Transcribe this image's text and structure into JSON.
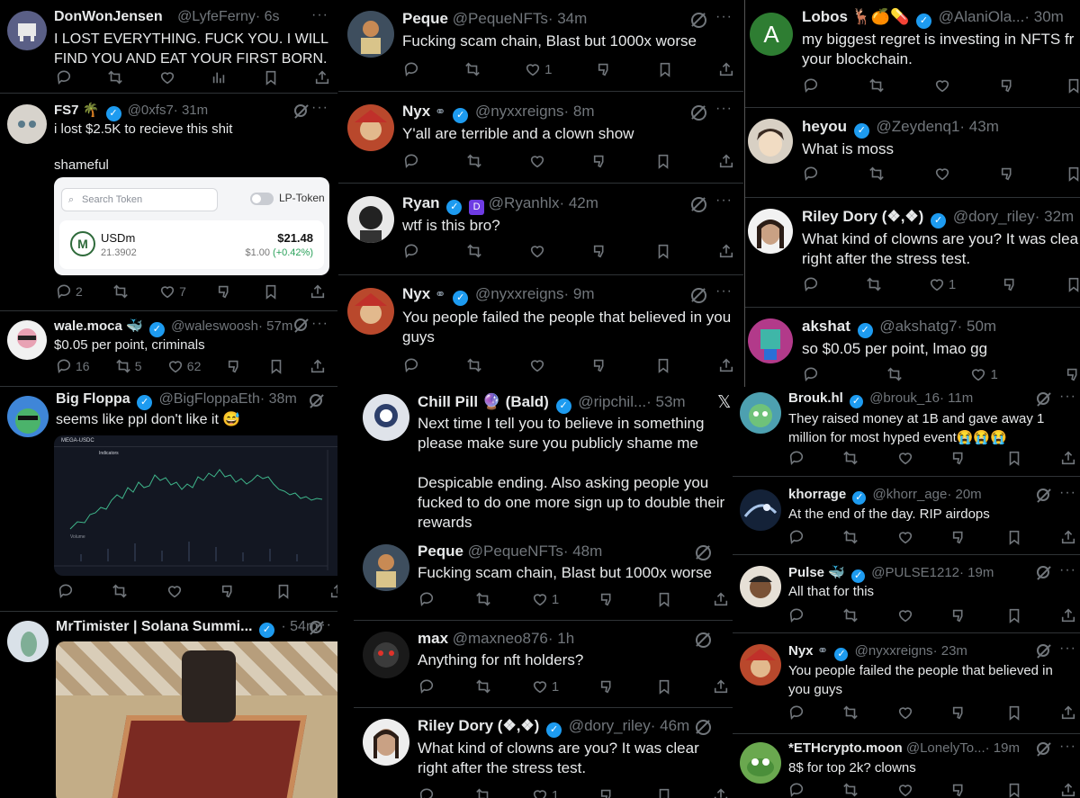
{
  "col1": {
    "tweets": [
      {
        "name": "DonWonJensen",
        "handle": "@LyfeFerny",
        "time": "· 6s",
        "text": "I LOST EVERYTHING. FUCK YOU. I WILL FIND YOU AND EAT YOUR FIRST BORN."
      },
      {
        "name": "FS7 🌴",
        "handle": "@0xfs7",
        "time": "· 31m",
        "text": "i lost $2.5K to recieve this shit\n\nshameful",
        "replies": "2",
        "likes": "7",
        "card": {
          "search_placeholder": "Search Token",
          "lp_label": "LP-Token",
          "token": "USDm",
          "amount": "21.3902",
          "value": "$21.48",
          "price": "$1.00",
          "change": "(+0.42%)"
        }
      },
      {
        "name": "wale.moca 🐳",
        "handle": "@waleswoosh",
        "time": "· 57m",
        "text": "$0.05 per point, criminals",
        "replies": "16",
        "retweets": "5",
        "likes": "62"
      },
      {
        "name": "Big Floppa",
        "handle": "@BigFloppaEth",
        "time": "· 38m",
        "text": "seems like ppl don't like it 😅",
        "chart_title": "MEGA-USDC",
        "chart_sub": "Indicators",
        "volume_label": "Volume"
      },
      {
        "name": "MrTimister | Solana Summi...",
        "handle": "",
        "time": "· 54m",
        "text": ""
      }
    ]
  },
  "col2": {
    "tweets": [
      {
        "name": "Peque",
        "handle": "@PequeNFTs",
        "time": "· 34m",
        "text": "Fucking scam chain, Blast but 1000x worse",
        "likes": "1"
      },
      {
        "name": "Nyx",
        "handle": "@nyxxreigns",
        "time": "· 8m",
        "text": "Y'all are terrible and a clown show"
      },
      {
        "name": "Ryan",
        "handle": "@Ryanhlx",
        "time": "· 42m",
        "text": "wtf is this bro?"
      },
      {
        "name": "Nyx",
        "handle": "@nyxxreigns",
        "time": "· 9m",
        "text": "You people failed the people that believed in you guys"
      },
      {
        "name": "Chill Pill 🔮 (Bald)",
        "handle": "@ripchil...",
        "time": "· 53m",
        "text": "Next time I tell you to believe in something please make sure you publicly shame me\n\nDespicable ending. Also asking people you fucked to do one more sign up to double their rewards",
        "x_logo": "𝕏"
      },
      {
        "name": "Peque",
        "handle": "@PequeNFTs",
        "time": "· 48m",
        "text": "Fucking scam chain, Blast but 1000x worse",
        "likes": "1"
      },
      {
        "name": "max",
        "handle": "@maxneo876",
        "time": "· 1h",
        "text": "Anything for nft holders?",
        "likes": "1"
      },
      {
        "name": "Riley Dory (❖,❖)",
        "handle": "@dory_riley",
        "time": "· 46m",
        "text": "What kind of clowns are you? It was clear right after the stress test.",
        "likes": "1"
      }
    ]
  },
  "col3": {
    "tweets": [
      {
        "name": "Lobos 🦌🍊💊",
        "handle": "@AlaniOla...",
        "time": "· 30m",
        "text": "my biggest regret is investing in NFTS fr your blockchain.",
        "avatar_letter": "A"
      },
      {
        "name": "heyou",
        "handle": "@Zeydenq1",
        "time": "· 43m",
        "text": "What is moss"
      },
      {
        "name": "Riley Dory (❖,❖)",
        "handle": "@dory_riley",
        "time": "· 32m",
        "text": "What kind of clowns are you? It was clea right after the stress test.",
        "likes": "1"
      },
      {
        "name": "akshat",
        "handle": "@akshatg7",
        "time": "· 50m",
        "text": "so $0.05 per point, lmao gg",
        "likes": "1"
      }
    ]
  },
  "col4": {
    "tweets": [
      {
        "name": "Brouk.hl",
        "handle": "@brouk_16",
        "time": "· 11m",
        "text": "They raised money at 1B and gave away 1 million for most hyped event😭😭😭"
      },
      {
        "name": "khorrage",
        "handle": "@khorr_age",
        "time": "· 20m",
        "text": "At the end of the day. RIP airdops"
      },
      {
        "name": "Pulse 🐳",
        "handle": "@PULSE1212",
        "time": "· 19m",
        "text": "All that for this"
      },
      {
        "name": "Nyx",
        "handle": "@nyxxreigns",
        "time": "· 23m",
        "text": "You people failed the people that believed in you guys"
      },
      {
        "name": "*ETHcrypto.moon",
        "handle": "@LonelyTo...",
        "time": "· 19m",
        "text": "8$ for top 2k? clowns"
      }
    ]
  }
}
